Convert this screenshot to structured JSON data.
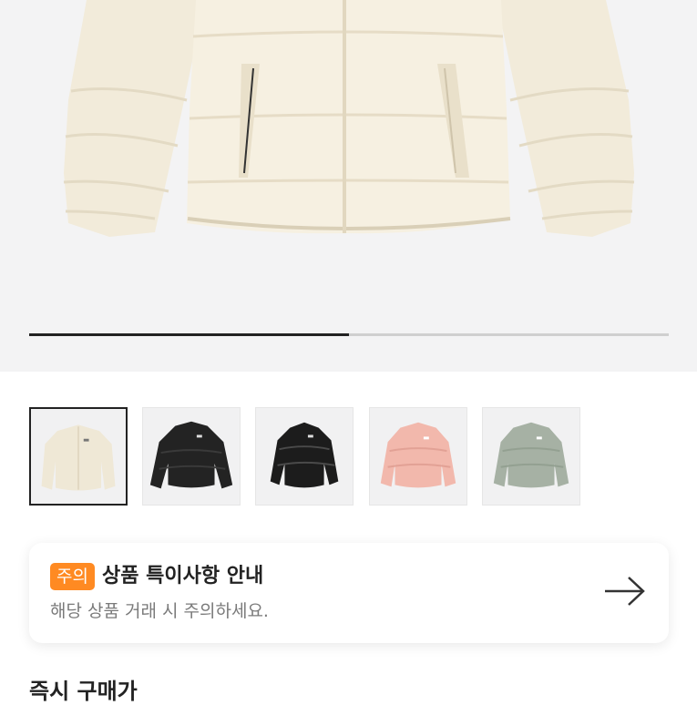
{
  "product": {
    "image_description_icon": "puffer-jacket-image",
    "gallery_progress": 0.5
  },
  "thumbnails": [
    {
      "name": "thumb-ivory-jacket",
      "color": "#efe9d8",
      "selected": true
    },
    {
      "name": "thumb-black-matte-jacket",
      "color": "#222222",
      "selected": false
    },
    {
      "name": "thumb-black-glossy-jacket",
      "color": "#1b1b1b",
      "selected": false
    },
    {
      "name": "thumb-pink-jacket",
      "color": "#f1b9ae",
      "selected": false
    },
    {
      "name": "thumb-sage-jacket",
      "color": "#a8b3a6",
      "selected": false
    }
  ],
  "notice": {
    "badge": "주의",
    "title": "상품 특이사항 안내",
    "subtitle": "해당 상품 거래 시 주의하세요.",
    "arrow_icon": "arrow-right-icon"
  },
  "section": {
    "title": "즉시 구매가"
  },
  "colors": {
    "badge": "#ff8a22",
    "hero_bg": "#f3f3f4"
  }
}
